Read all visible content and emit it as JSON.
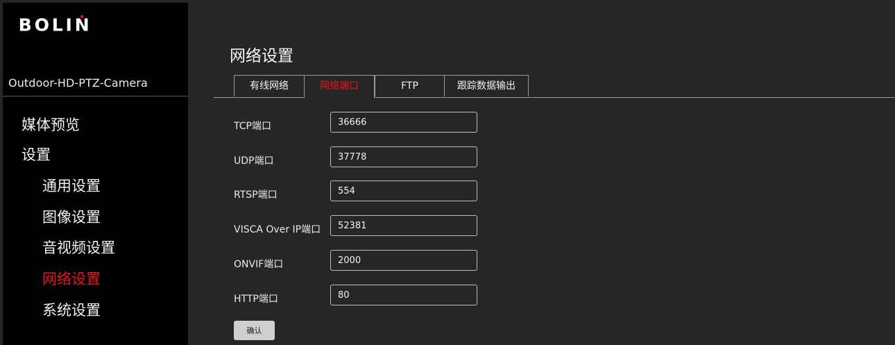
{
  "sidebar": {
    "logo": "BOLIN",
    "device_name": "Outdoor-HD-PTZ-Camera",
    "items": [
      {
        "label": "媒体预览"
      },
      {
        "label": "设置"
      },
      {
        "label": "通用设置"
      },
      {
        "label": "图像设置"
      },
      {
        "label": "音视频设置"
      },
      {
        "label": "网络设置"
      },
      {
        "label": "系统设置"
      }
    ],
    "active_item": "网络设置"
  },
  "main": {
    "title": "网络设置",
    "tabs": [
      {
        "label": "有线网络"
      },
      {
        "label": "网络端口"
      },
      {
        "label": "FTP"
      },
      {
        "label": "跟踪数据输出"
      }
    ],
    "active_tab": "网络端口",
    "fields": [
      {
        "label": "TCP端口",
        "value": "36666"
      },
      {
        "label": "UDP端口",
        "value": "37778"
      },
      {
        "label": "RTSP端口",
        "value": "554"
      },
      {
        "label": "VISCA Over IP端口",
        "value": "52381"
      },
      {
        "label": "ONVIF端口",
        "value": "2000"
      },
      {
        "label": "HTTP端口",
        "value": "80"
      }
    ],
    "confirm_label": "确认"
  },
  "colors": {
    "active": "#e8161b",
    "sidebar_bg": "#000000",
    "main_bg": "#262626"
  }
}
